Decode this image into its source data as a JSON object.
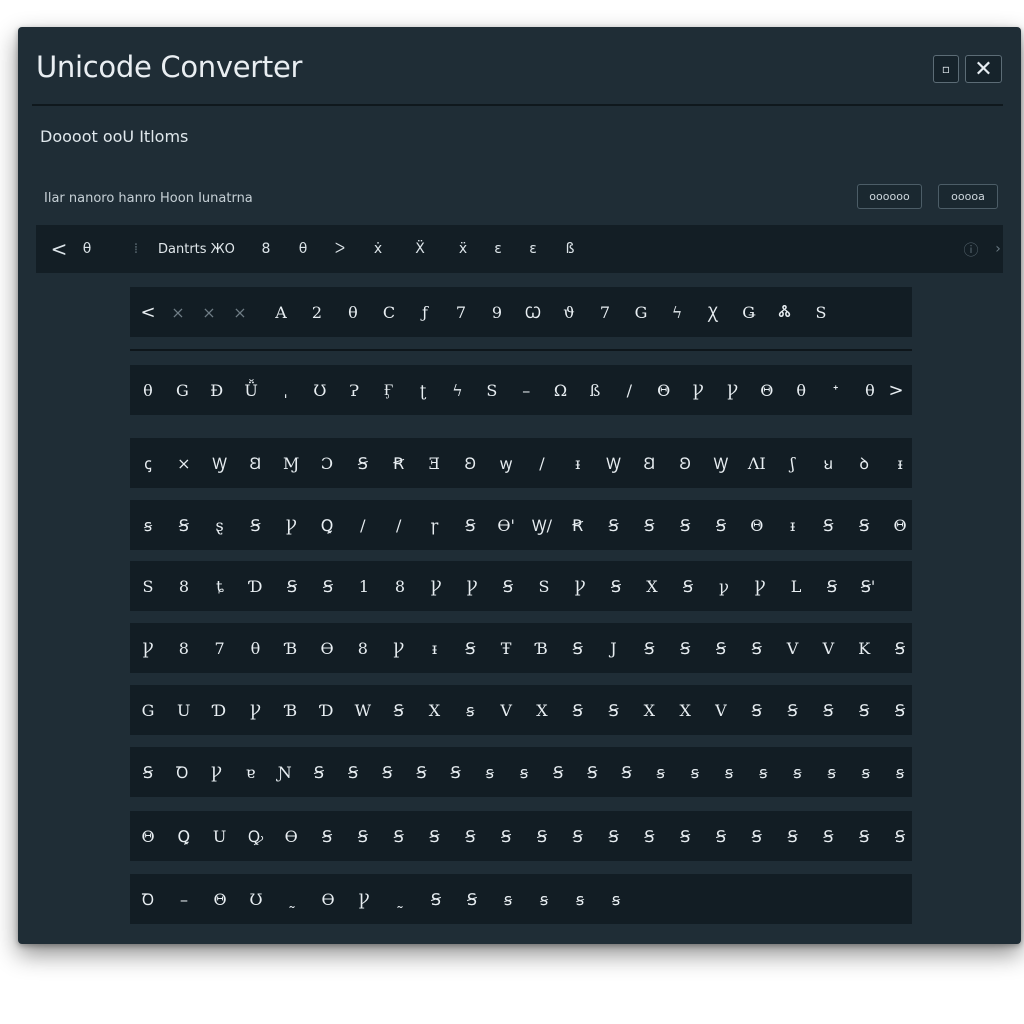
{
  "window": {
    "title": "Unicode Converter",
    "restore_icon": "restore-icon",
    "close_label": "✕",
    "subtitle": "Doooot ooU Itloms",
    "options_label": "Ilar nanoro hanro  Hoon Iunatrna",
    "buttons": [
      "oooooo",
      "ooooa"
    ]
  },
  "toolbar": {
    "back": "<",
    "circle": "θ",
    "separator": "⁞",
    "label": "Dantrts ЖО",
    "glyphs": [
      "8",
      "θ",
      "ᐳ",
      "ẋ",
      "Ẍ",
      "ẍ",
      "ɛ",
      "ɛ",
      "ß"
    ],
    "info": "ⓘ",
    "next": "›"
  },
  "grid": {
    "rows": [
      {
        "nav_start": "<",
        "dim": [
          "×",
          "×",
          "×"
        ],
        "chars": [
          "A",
          "2",
          "θ",
          "C",
          "ƒ",
          "7",
          "9",
          "Ꞷ",
          "ϑ",
          "7",
          "G",
          "ϟ",
          "Ꭓ",
          "Ǥ",
          "Ꮬ",
          "S"
        ]
      },
      {
        "chars": [
          "θ",
          "G",
          "Ð",
          "Ǚ",
          "ˌ",
          "Ʊ",
          "Ɂ",
          "Ӻ",
          "ʈ",
          "ϟ",
          "S",
          "–",
          "Ω",
          "ß",
          "/",
          "Θ",
          "Ꝩ",
          "Ꝩ",
          "Θ",
          "θ",
          "ᐩ",
          "θ"
        ],
        "nav_end": ">"
      },
      {
        "chars": [
          "ꞔ",
          "×",
          "Ꝡ",
          "Ꞛ",
          "Ɱ",
          "Ɔ",
          "Ꞩ",
          "Ꞧ",
          "Ǝ",
          "Ꞝ",
          "ꝡ",
          "/",
          "ᵻ",
          "Ꝡ",
          "Ꞛ",
          "Ꞝ",
          "Ꝡ",
          "ɅI",
          "ʃ",
          "ꞟ",
          "ꝺ",
          "ᵻ"
        ]
      },
      {
        "chars": [
          "ꞩ",
          "Ꞩ",
          "ȿ",
          "Ꞩ",
          "Ꝩ",
          "Ꝗ",
          "/",
          "/",
          "ꞅ",
          "Ꞩ",
          "Ɵ'",
          "Ꝡ/",
          "Ꞧ",
          "Ꞩ",
          "Ꞩ",
          "Ꞩ",
          "Ꞩ",
          "Θ",
          "ᵻ",
          "Ꞩ",
          "Ꞩ",
          "Θ"
        ]
      },
      {
        "chars": [
          "S",
          "8",
          "ȶ",
          "Ɗ",
          "Ꞩ",
          "Ꞩ",
          "1",
          "8",
          "Ꝩ",
          "Ꝩ",
          "Ꞩ",
          "S",
          "Ꝩ",
          "Ꞩ",
          "X",
          "Ꞩ",
          "ꝩ",
          "Ꝩ",
          "L",
          "Ꞩ",
          "Ꞩ'"
        ]
      },
      {
        "chars": [
          "Ꝩ",
          "8",
          "7",
          "θ",
          "Ɓ",
          "Ɵ",
          "8",
          "Ꝩ",
          "ᵻ",
          "Ꞩ",
          "Ŧ",
          "Ɓ",
          "Ꞩ",
          "J",
          "Ꞩ",
          "Ꞩ",
          "Ꞩ",
          "Ꞩ",
          "V",
          "V",
          "K",
          "Ꞩ"
        ]
      },
      {
        "chars": [
          "G",
          "U",
          "Ɗ",
          "Ꝩ",
          "Ɓ",
          "Ɗ",
          "W",
          "Ꞩ",
          "X",
          "ꞩ",
          "V",
          "X",
          "Ꞩ",
          "Ꞩ",
          "X",
          "X",
          "V",
          "Ꞩ",
          "Ꞩ",
          "Ꞩ",
          "Ꞩ",
          "Ꞩ"
        ]
      },
      {
        "chars": [
          "Ꞩ",
          "Ꝺ",
          "Ꝩ",
          "ɐ",
          "Ɲ",
          "Ꞩ",
          "Ꞩ",
          "Ꞩ",
          "Ꞩ",
          "Ꞩ",
          "ꞩ",
          "ꞩ",
          "Ꞩ",
          "Ꞩ",
          "Ꞩ",
          "ꞩ",
          "ꞩ",
          "ꞩ",
          "ꞩ",
          "ꞩ",
          "ꞩ",
          "ꞩ",
          "ꞩ"
        ]
      },
      {
        "chars": [
          "Θ",
          "Ꝗ",
          "U",
          "Ꝙ",
          "Ɵ",
          "Ꞩ",
          "Ꞩ",
          "Ꞩ",
          "Ꞩ",
          "Ꞩ",
          "Ꞩ",
          "Ꞩ",
          "Ꞩ",
          "Ꞩ",
          "Ꞩ",
          "Ꞩ",
          "Ꞩ",
          "Ꞩ",
          "Ꞩ",
          "Ꞩ",
          "Ꞩ",
          "Ꞩ"
        ]
      },
      {
        "chars": [
          "Ꝺ",
          "–",
          "Θ",
          "Ʊ",
          "˷",
          "Ɵ",
          "Ꝩ",
          "˷",
          "Ꞩ",
          "Ꞩ",
          "ꞩ",
          "ꞩ",
          "ꞩ",
          "ꞩ"
        ]
      }
    ]
  }
}
